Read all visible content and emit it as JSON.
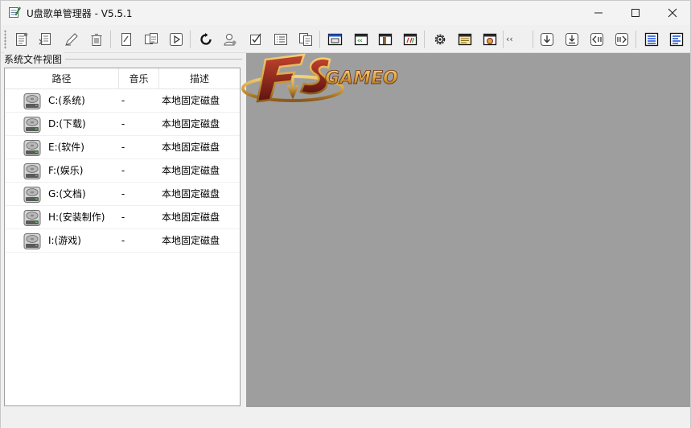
{
  "window": {
    "title": "U盘歌单管理器  - V5.5.1"
  },
  "toolbar": {
    "buttons": [
      "new-list-icon",
      "open-list-icon",
      "edit-icon",
      "delete-icon",
      "edit-doc-icon",
      "copy-doc-icon",
      "play-icon",
      "refresh-icon",
      "user-icon",
      "checklist-icon",
      "list-icon",
      "copy-icon",
      "window-icon",
      "prev-panel-icon",
      "mid-panel-icon",
      "code-icon",
      "gear-icon",
      "note-icon",
      "logo-icon",
      "down-arrow-icon",
      "download-icon",
      "left-arrow-icon",
      "right-arrow-icon",
      "list-blue-icon",
      "align-blue-icon"
    ],
    "overflow_label": "‹‹"
  },
  "panel": {
    "title": "系统文件视图",
    "columns": {
      "path": "路径",
      "music": "音乐",
      "desc": "描述"
    },
    "rows": [
      {
        "path": "C:(系统)",
        "music": "-",
        "desc": "本地固定磁盘"
      },
      {
        "path": "D:(下载)",
        "music": "-",
        "desc": "本地固定磁盘"
      },
      {
        "path": "E:(软件)",
        "music": "-",
        "desc": "本地固定磁盘"
      },
      {
        "path": "F:(娱乐)",
        "music": "-",
        "desc": "本地固定磁盘"
      },
      {
        "path": "G:(文档)",
        "music": "-",
        "desc": "本地固定磁盘"
      },
      {
        "path": "H:(安装制作)",
        "music": "-",
        "desc": "本地固定磁盘"
      },
      {
        "path": "I:(游戏)",
        "music": "-",
        "desc": "本地固定磁盘"
      }
    ]
  },
  "logo": {
    "text": "GAMEO"
  },
  "colors": {
    "accent": "#1a4fd6",
    "content_bg": "#9e9e9e",
    "logo_gold": "#d9a441",
    "logo_red": "#8c1d16"
  }
}
